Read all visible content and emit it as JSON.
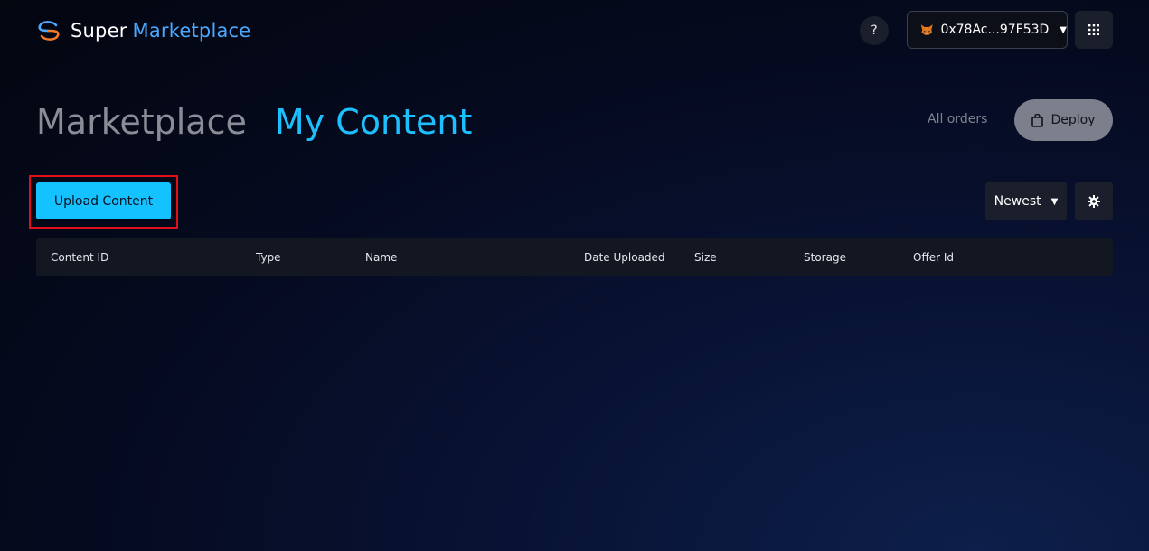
{
  "header": {
    "logo": {
      "word1": "Super",
      "word2": "Marketplace"
    },
    "help_label": "?",
    "wallet": {
      "address": "0x78Ac...97F53D",
      "icon": "metamask-fox-icon"
    },
    "apps_icon": "grid-icon"
  },
  "tabs": [
    {
      "label": "Marketplace",
      "active": false
    },
    {
      "label": "My Content",
      "active": true
    }
  ],
  "actions": {
    "all_orders_label": "All orders",
    "deploy_label": "Deploy",
    "deploy_icon": "bag-icon"
  },
  "toolbar": {
    "upload_label": "Upload Content",
    "sort_label": "Newest",
    "settings_icon": "gear-icon"
  },
  "table": {
    "columns": [
      "Content ID",
      "Type",
      "Name",
      "Date Uploaded",
      "Size",
      "Storage",
      "Offer Id"
    ],
    "rows": []
  },
  "colors": {
    "accent": "#14c2ff",
    "brand_blue": "#4aa8ff",
    "highlight": "#e0101a",
    "background": "#050a1f"
  }
}
